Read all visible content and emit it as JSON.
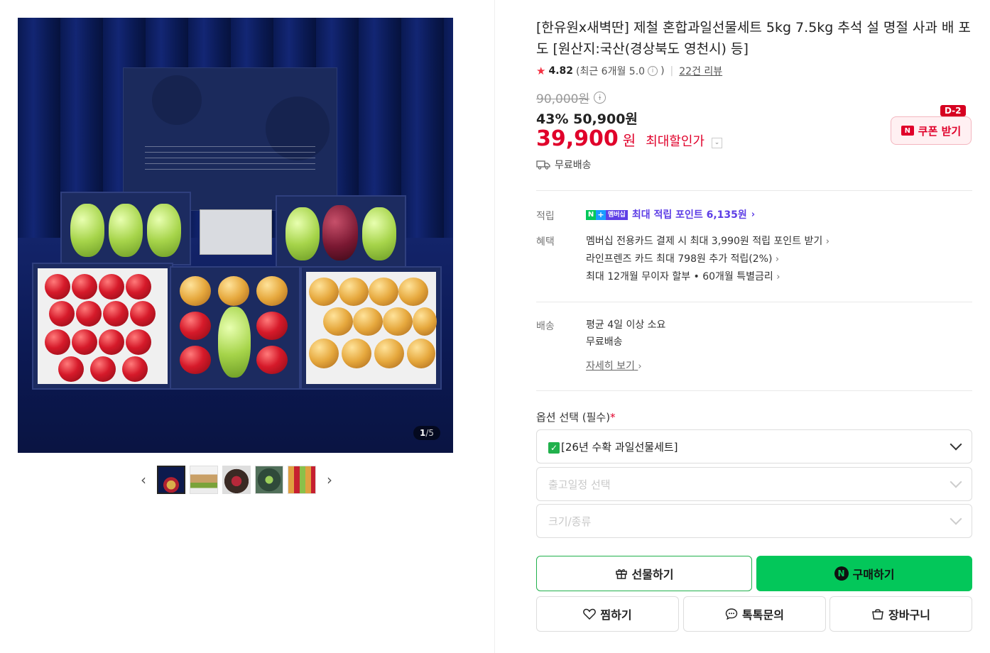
{
  "gallery": {
    "page_current": "1",
    "page_total": "/5",
    "prev_icon": "chevron-left-icon",
    "next_icon": "chevron-right-icon",
    "thumbnail_count": 5
  },
  "product": {
    "title": "[한유원x새벽딴] 제철 혼합과일선물세트 5kg 7.5kg 추석 설 명절 사과 배 포도 [원산지:국산(경상북도 영천시) 등]",
    "rating": "4.82",
    "rating_recent": "(최근 6개월 5.0",
    "rating_recent_close": ")",
    "review_link": "22건 리뷰",
    "original_price": "90,000원",
    "discount_line": "43% 50,900원",
    "final_price": "39,900",
    "final_unit": "원",
    "max_discount_label": "최대할인가",
    "free_shipping": "무료배송"
  },
  "coupon": {
    "badge": "D-2",
    "n_logo": "N",
    "label": "쿠폰 받기"
  },
  "points": {
    "label": "적립",
    "badge_n": "N",
    "badge_plus": "+",
    "badge_member": "멤버십",
    "text": "최대 적립 포인트 6,135원"
  },
  "benefits": {
    "label": "혜택",
    "items": [
      "멤버십 전용카드 결제 시 최대 3,990원 적립 포인트 받기",
      "라인프렌즈 카드 최대 798원 추가 적립(2%)",
      "최대 12개월 무이자 할부 • 60개월 특별금리"
    ]
  },
  "shipping": {
    "label": "배송",
    "line1": "평균 4일 이상 소요",
    "line2": "무료배송",
    "detail_link": "자세히 보기"
  },
  "options": {
    "title": "옵션 선택 (필수)",
    "required_mark": "*",
    "selected": "[26년 수확 과일선물세트]",
    "select2_placeholder": "출고일정 선택",
    "select3_placeholder": "크기/종류"
  },
  "actions": {
    "gift": "선물하기",
    "buy": "구매하기",
    "buy_n": "N",
    "wish": "찜하기",
    "talk": "톡톡문의",
    "cart": "장바구니"
  },
  "colors": {
    "price_red": "#e0002a",
    "naver_green": "#03c75a",
    "points_purple": "#5e3fe6"
  }
}
